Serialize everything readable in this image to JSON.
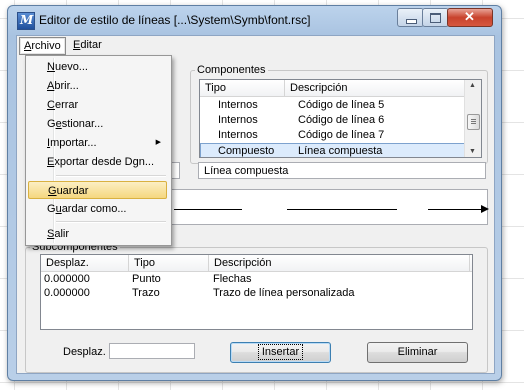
{
  "window": {
    "title": "Editor de estilo de líneas [...\\System\\Symb\\font.rsc]",
    "icon": "microstation-icon"
  },
  "menubar": {
    "archivo": {
      "pre": "",
      "key": "A",
      "post": "rchivo"
    },
    "editar": {
      "pre": "",
      "key": "E",
      "post": "ditar"
    }
  },
  "archivo_menu": {
    "items": [
      {
        "pre": "",
        "key": "N",
        "post": "uevo..."
      },
      {
        "pre": "",
        "key": "A",
        "post": "brir..."
      },
      {
        "pre": "",
        "key": "C",
        "post": "errar"
      },
      {
        "pre": "G",
        "key": "e",
        "post": "stionar..."
      },
      {
        "pre": "",
        "key": "I",
        "post": "mportar..."
      },
      {
        "pre": "",
        "key": "E",
        "post": "xportar desde Dgn..."
      },
      {
        "pre": "",
        "key": "G",
        "post": "uardar"
      },
      {
        "pre": "G",
        "key": "u",
        "post": "ardar como..."
      },
      {
        "pre": "",
        "key": "S",
        "post": "alir"
      }
    ],
    "highlighted": "Guardar"
  },
  "componentes": {
    "legend": "Componentes",
    "columns": [
      "Tipo",
      "Descripción"
    ],
    "rows": [
      {
        "tipo": "Internos",
        "descripcion": "Código de línea 5"
      },
      {
        "tipo": "Internos",
        "descripcion": "Código de línea 6"
      },
      {
        "tipo": "Internos",
        "descripcion": "Código de línea 7"
      },
      {
        "tipo": "Compuesto",
        "descripcion": "Línea compuesta"
      }
    ],
    "selected_index": 3,
    "name_value": "Línea compuesta"
  },
  "subcomponentes": {
    "legend": "Subcomponentes",
    "columns": [
      "Desplaz.",
      "Tipo",
      "Descripción"
    ],
    "rows": [
      {
        "desplaz": "0.000000",
        "tipo": "Punto",
        "descripcion": "Flechas"
      },
      {
        "desplaz": "0.000000",
        "tipo": "Trazo",
        "descripcion": "Trazo de línea personalizada"
      }
    ]
  },
  "bottom": {
    "desplaz_label": "Desplaz.",
    "desplaz_value": "",
    "insertar": "Insertar",
    "eliminar": "Eliminar"
  }
}
